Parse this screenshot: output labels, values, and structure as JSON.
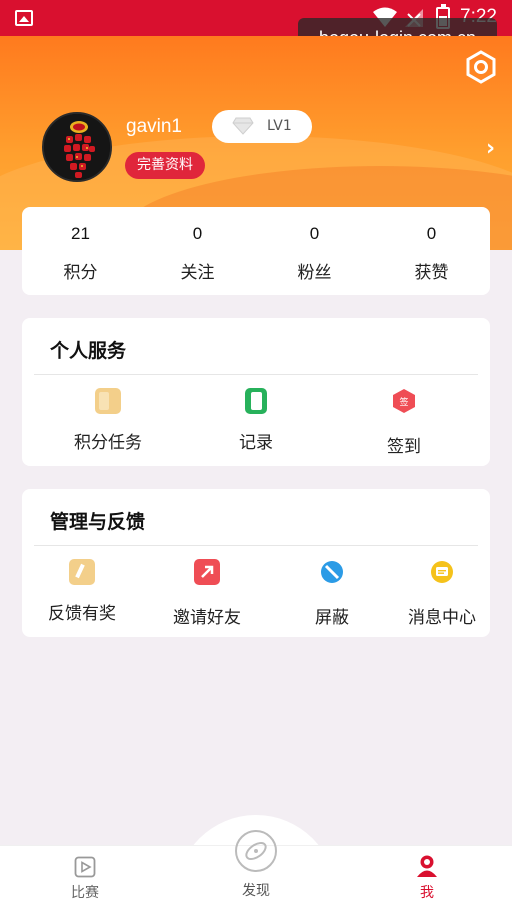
{
  "status_bar": {
    "time": "7:22"
  },
  "watermark": "bogou-login.com.cn",
  "profile": {
    "username": "gavin1",
    "level": "LV1",
    "complete_profile_label": "完善资料"
  },
  "stats": [
    {
      "value": "21",
      "label": "积分"
    },
    {
      "value": "0",
      "label": "关注"
    },
    {
      "value": "0",
      "label": "粉丝"
    },
    {
      "value": "0",
      "label": "获赞"
    }
  ],
  "personal_services": {
    "title": "个人服务",
    "items": [
      {
        "label": "积分任务",
        "icon": "points-task-icon",
        "color": "#f3cf8a"
      },
      {
        "label": "记录",
        "icon": "record-icon",
        "color": "#27b15b"
      },
      {
        "label": "签到",
        "icon": "checkin-icon",
        "color": "#ef4d55",
        "glyph": "签"
      }
    ]
  },
  "management": {
    "title": "管理与反馈",
    "items": [
      {
        "label": "反馈有奖",
        "icon": "feedback-icon",
        "color": "#f3cf8a"
      },
      {
        "label": "邀请好友",
        "icon": "invite-icon",
        "color": "#ef4d55"
      },
      {
        "label": "屏蔽",
        "icon": "block-icon",
        "color": "#2b9be6"
      },
      {
        "label": "消息中心",
        "icon": "message-icon",
        "color": "#f5c21b"
      }
    ]
  },
  "bottom_nav": {
    "match": "比赛",
    "discover": "发现",
    "me": "我"
  },
  "colors": {
    "status_bar": "#d9102f",
    "accent_red": "#e0263b",
    "header_orange": "#ff8a22"
  }
}
